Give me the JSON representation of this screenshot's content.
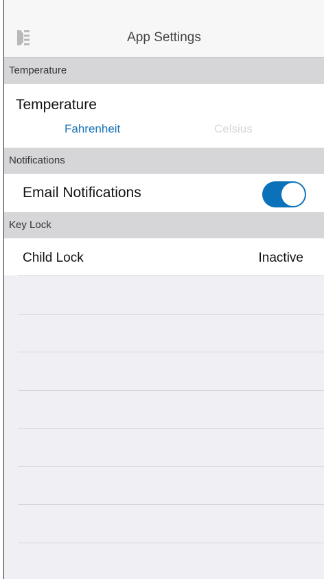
{
  "nav": {
    "title": "App Settings",
    "menu_icon": "sidebar-menu-icon"
  },
  "sections": {
    "temperature": {
      "header": "Temperature",
      "row_label": "Temperature",
      "options": [
        "Fahrenheit",
        "Celsius"
      ],
      "selected": "Fahrenheit"
    },
    "notifications": {
      "header": "Notifications",
      "email_label": "Email Notifications",
      "email_enabled": true
    },
    "key_lock": {
      "header": "Key Lock",
      "child_lock_label": "Child Lock",
      "child_lock_value": "Inactive"
    }
  },
  "colors": {
    "accent": "#0b72b9",
    "selected_text": "#1a73b8",
    "unselected_text": "#d8d8d8",
    "section_header_bg": "#d6d6d9",
    "background": "#efeff4"
  }
}
